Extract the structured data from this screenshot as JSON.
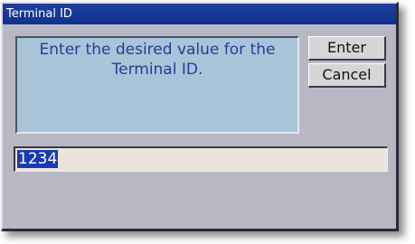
{
  "window": {
    "title": "Terminal ID"
  },
  "message": {
    "line1": "Enter the desired value for the",
    "line2": "Terminal ID."
  },
  "buttons": {
    "enter_label": "Enter",
    "cancel_label": "Cancel"
  },
  "input": {
    "value": "1234",
    "selected": true
  },
  "colors": {
    "titlebar": "#12308c",
    "message_bg": "#a9c4d8",
    "message_text": "#1f3f9a",
    "dialog_bg": "#b8b8c4",
    "selection": "#1a3bb0"
  }
}
